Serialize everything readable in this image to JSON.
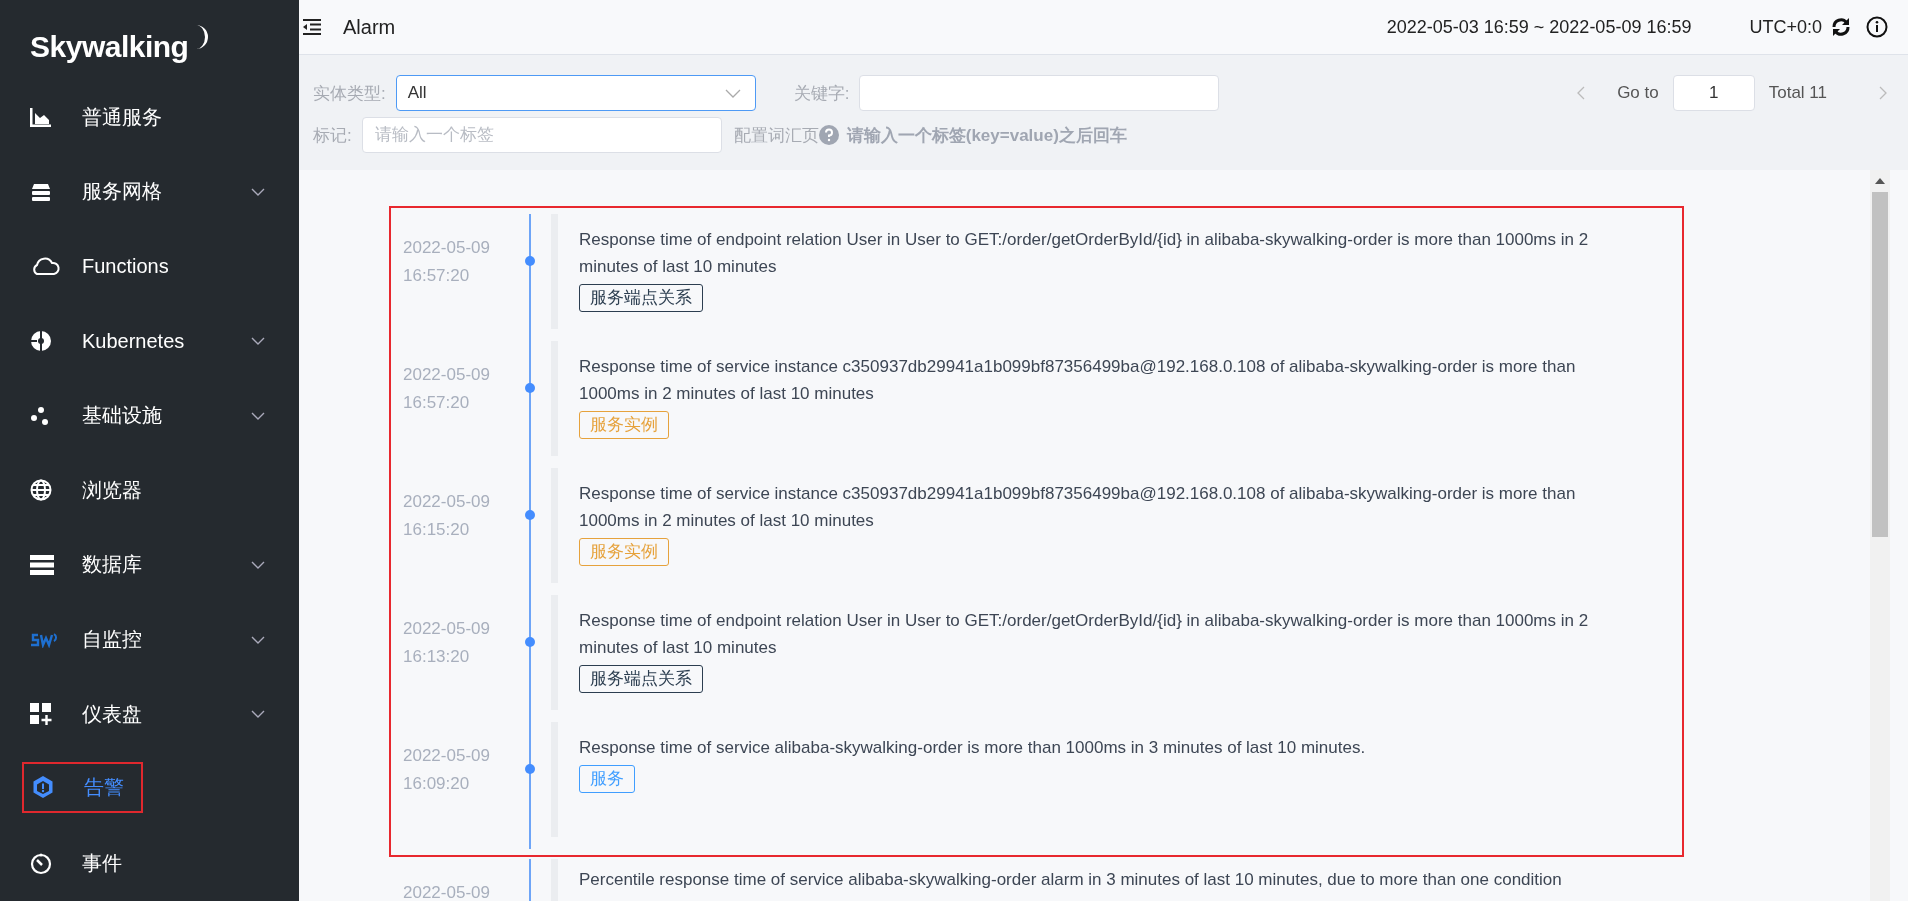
{
  "sidebar": {
    "logo": "Skywalking",
    "items": [
      {
        "label": "普通服务",
        "expandable": false,
        "selected": false,
        "annotated": false
      },
      {
        "label": "服务网格",
        "expandable": true,
        "selected": false,
        "annotated": false
      },
      {
        "label": "Functions",
        "expandable": false,
        "selected": false,
        "annotated": false
      },
      {
        "label": "Kubernetes",
        "expandable": true,
        "selected": false,
        "annotated": false
      },
      {
        "label": "基础设施",
        "expandable": true,
        "selected": false,
        "annotated": false
      },
      {
        "label": "浏览器",
        "expandable": false,
        "selected": false,
        "annotated": false
      },
      {
        "label": "数据库",
        "expandable": true,
        "selected": false,
        "annotated": false
      },
      {
        "label": "自监控",
        "expandable": true,
        "selected": false,
        "annotated": false
      },
      {
        "label": "仪表盘",
        "expandable": true,
        "selected": false,
        "annotated": false
      },
      {
        "label": "告警",
        "expandable": false,
        "selected": true,
        "annotated": true
      },
      {
        "label": "事件",
        "expandable": false,
        "selected": false,
        "annotated": false
      }
    ]
  },
  "header": {
    "title": "Alarm",
    "time_range": "2022-05-03 16:59 ~ 2022-05-09 16:59",
    "timezone": "UTC+0:0"
  },
  "filters": {
    "entity_type": {
      "label": "实体类型:",
      "value": "All"
    },
    "keyword": {
      "label": "关键字:"
    },
    "tag": {
      "label": "标记:",
      "placeholder": "请输入一个标签"
    },
    "vocab_link": "配置词汇页",
    "hint": "请输入一个标签(key=value)之后回车"
  },
  "pagination": {
    "goto_label": "Go to",
    "page": "1",
    "total": "Total 11"
  },
  "alarm_groups": [
    {
      "annotated": true,
      "items": [
        {
          "date": "2022-05-09",
          "time": "16:57:20",
          "message": "Response time of endpoint relation User in User to GET:/order/getOrderById/{id} in alibaba-skywalking-order is more than 1000ms in 2 minutes of last 10 minutes",
          "tag": "服务端点关系",
          "color": "#2c3e50"
        },
        {
          "date": "2022-05-09",
          "time": "16:57:20",
          "message": "Response time of service instance c350937db29941a1b099bf87356499ba@192.168.0.108 of alibaba-skywalking-order is more than 1000ms in 2 minutes of last 10 minutes",
          "tag": "服务实例",
          "color": "#e6a23c"
        },
        {
          "date": "2022-05-09",
          "time": "16:15:20",
          "message": "Response time of service instance c350937db29941a1b099bf87356499ba@192.168.0.108 of alibaba-skywalking-order is more than 1000ms in 2 minutes of last 10 minutes",
          "tag": "服务实例",
          "color": "#e6a23c"
        },
        {
          "date": "2022-05-09",
          "time": "16:13:20",
          "message": "Response time of endpoint relation User in User to GET:/order/getOrderById/{id} in alibaba-skywalking-order is more than 1000ms in 2 minutes of last 10 minutes",
          "tag": "服务端点关系",
          "color": "#2c3e50"
        },
        {
          "date": "2022-05-09",
          "time": "16:09:20",
          "message": "Response time of service alibaba-skywalking-order is more than 1000ms in 3 minutes of last 10 minutes.",
          "tag": "服务",
          "color": "#409eff"
        }
      ]
    },
    {
      "annotated": false,
      "items": [
        {
          "date": "2022-05-09",
          "message": "Percentile response time of service alibaba-skywalking-order alarm in 3 minutes of last 10 minutes, due to more than one condition"
        }
      ]
    }
  ]
}
